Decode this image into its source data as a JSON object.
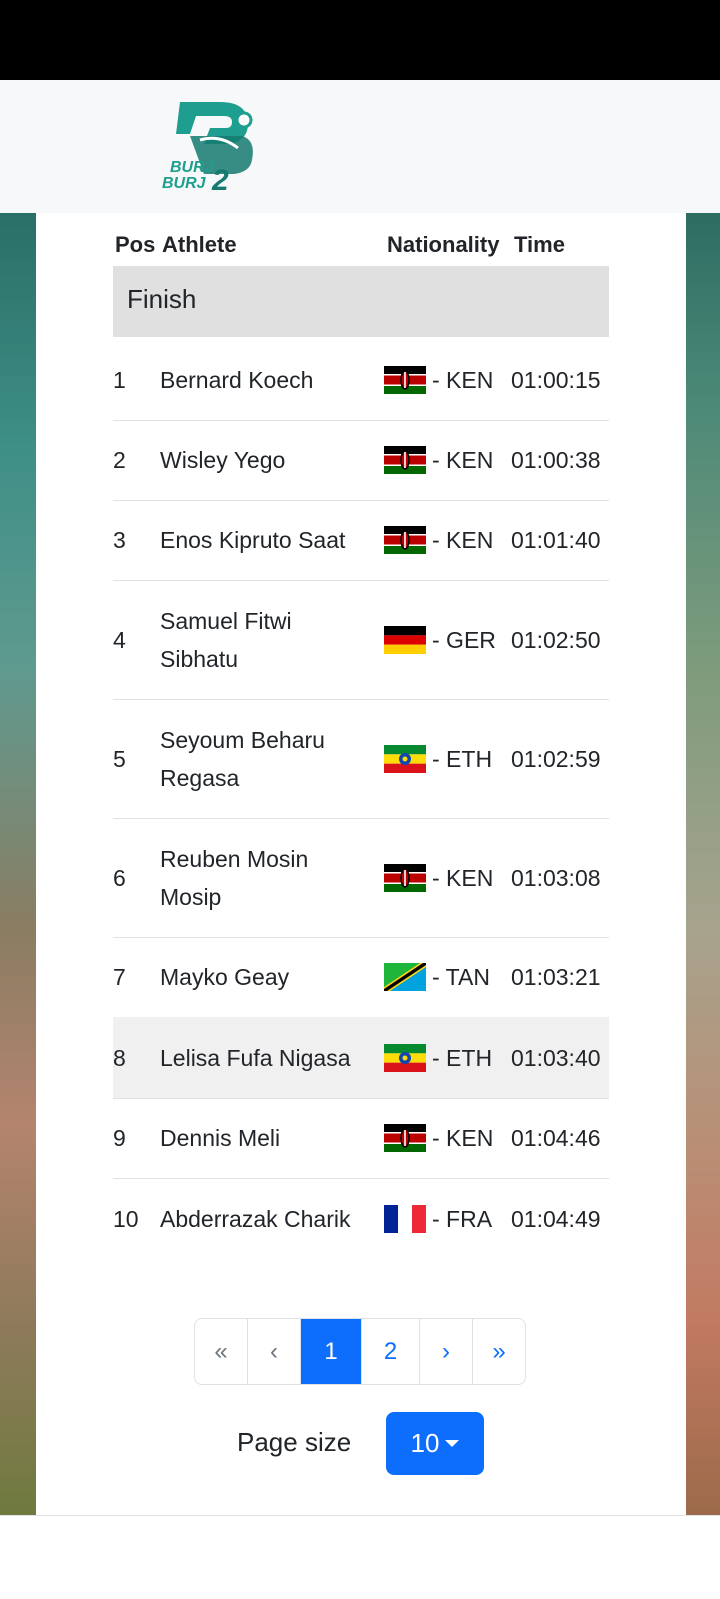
{
  "brand": {
    "logo_line1": "BURJ",
    "logo_line2": "BURJ",
    "logo_num": "2"
  },
  "table": {
    "headers": {
      "pos": "Pos",
      "athlete": "Athlete",
      "nationality": "Nationality",
      "time": "Time"
    },
    "group_label": "Finish",
    "rows": [
      {
        "pos": "1",
        "athlete": "Bernard Koech",
        "nationality": "- KEN",
        "flag": "kenya-flag-icon",
        "time": "01:00:15"
      },
      {
        "pos": "2",
        "athlete": "Wisley Yego",
        "nationality": "- KEN",
        "flag": "kenya-flag-icon",
        "time": "01:00:38"
      },
      {
        "pos": "3",
        "athlete": "Enos Kipruto Saat",
        "nationality": "- KEN",
        "flag": "kenya-flag-icon",
        "time": "01:01:40"
      },
      {
        "pos": "4",
        "athlete": "Samuel Fitwi Sibhatu",
        "nationality": "- GER",
        "flag": "germany-flag-icon",
        "time": "01:02:50"
      },
      {
        "pos": "5",
        "athlete": "Seyoum Beharu Regasa",
        "nationality": "- ETH",
        "flag": "ethiopia-flag-icon",
        "time": "01:02:59"
      },
      {
        "pos": "6",
        "athlete": "Reuben Mosin Mosip",
        "nationality": "- KEN",
        "flag": "kenya-flag-icon",
        "time": "01:03:08"
      },
      {
        "pos": "7",
        "athlete": "Mayko Geay",
        "nationality": "- TAN",
        "flag": "tanzania-flag-icon",
        "time": "01:03:21"
      },
      {
        "pos": "8",
        "athlete": "Lelisa Fufa Nigasa",
        "nationality": "- ETH",
        "flag": "ethiopia-flag-icon",
        "time": "01:03:40"
      },
      {
        "pos": "9",
        "athlete": "Dennis Meli",
        "nationality": "- KEN",
        "flag": "kenya-flag-icon",
        "time": "01:04:46"
      },
      {
        "pos": "10",
        "athlete": "Abderrazak Charik",
        "nationality": "- FRA",
        "flag": "france-flag-icon",
        "time": "01:04:49"
      }
    ]
  },
  "pagination": {
    "first": "«",
    "prev": "‹",
    "page1": "1",
    "page2": "2",
    "next": "›",
    "last": "»",
    "current": 1
  },
  "page_size": {
    "label": "Page size",
    "value": "10"
  },
  "colors": {
    "accent": "#0d6efd",
    "brand_teal": "#1e9e8e"
  }
}
